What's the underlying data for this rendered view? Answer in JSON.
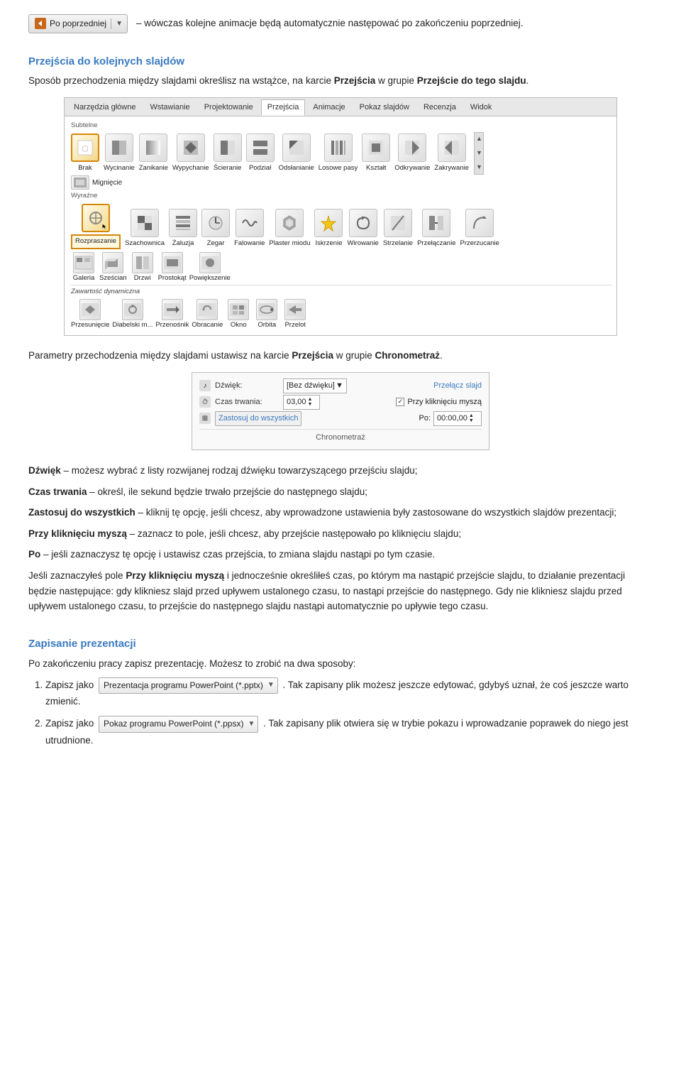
{
  "topSection": {
    "buttonLabel": "Po poprzedniej",
    "buttonDropdown": "▼",
    "topText": "– wówczas kolejne animacje będą automatycznie następować po zakończeniu poprzedniej."
  },
  "section1": {
    "heading": "Przejścia do kolejnych slajdów",
    "introText": "Sposób przechodzenia między slajdami określisz na wstążce, na karcie ",
    "introTextBold": "Przejścia",
    "introTextRest": " w grupie ",
    "introTextBold2": "Przejście do tego slajdu",
    "introTextEnd": "."
  },
  "ribbon1": {
    "tabs": [
      "Narzędzia główne",
      "Wstawianie",
      "Projektowanie",
      "Przejścia",
      "Animacje",
      "Pokaz slajdów",
      "Recenzja",
      "Widok"
    ],
    "activeTab": "Przejścia",
    "subtelneLabel": "Subtelne",
    "brakLabel": "Brak",
    "wycinaniaLabel": "Wycinanie",
    "zanikaLabel": "Zanikanie",
    "wypychanieLabel": "Wypychanie",
    "scieranieLabel": "Ścieranie",
    "podzialLabel": "Podział",
    "odslonianieLabel": "Odsłanianie",
    "losowePasyLabel": "Losowe pasy",
    "ksztaltLabel": "Kształt",
    "odkrywaniaLabel": "Odkrywanie",
    "zakrywanieLabel": "Zakrywanie",
    "mignieciLabel": "Mignięcie",
    "wyraziscieLabel": "Wyraźne",
    "rozprascanieLabel": "Rozpraszanie",
    "szachownicaLabel": "Szachownica",
    "zaluzjaLabel": "Żaluzja",
    "zegarLabel": "Zegar",
    "falowanieLabel": "Falowanie",
    "plasterMioduLabel": "Plaster miodu",
    "iskrzenieLabel": "Iskrzenie",
    "wirowanieLabel": "Wirowanie",
    "strzelanieLabel": "Strzelanie",
    "przelaczanieLabel": "Przełączanie",
    "przerzucanieLabel": "Przerzucanie",
    "galeriaLabel": "Galeria",
    "szescianLabel": "Sześcian",
    "drzwiLabel": "Drzwi",
    "prostokatLabel": "Prostokąt",
    "powiekszanieLabel": "Powiększenie",
    "zawartoscDynamicznaLabel": "Zawartość dynamiczna",
    "przesunieciLabel": "Przesunięcie",
    "diabelskiMlynLabel": "Diabelski m...",
    "przenosnikLabel": "Przenośnik",
    "obracableLabel": "Obracanie",
    "oknoLabel": "Okno",
    "orbitaLabel": "Orbita",
    "przelotLabel": "Przelot"
  },
  "section2": {
    "text": "Parametry przechodzenia między slajdami ustawisz na karcie ",
    "boldText": "Przejścia",
    "textRest": " w grupie ",
    "boldText2": "Chronometraż",
    "textEnd": "."
  },
  "chrono": {
    "row1Label": "Dźwięk:",
    "row1Value": "[Bez dźwięku]",
    "row1RightLabel": "Przełącz slajd",
    "row2Label": "Czas trwania:",
    "row2Value": "03,00",
    "row2Checkbox": "✓",
    "row2RightLabel": "Przy kliknięciu myszą",
    "row3Label": "Zastosuj do wszystkich",
    "row3RightLabel": "Po:",
    "row3RightValue": "00:00,00",
    "groupTitle": "Chronometraż"
  },
  "descriptions": {
    "dzwiekBold": "Dźwięk",
    "dzwiekText": " – możesz wybrać z listy rozwijanej rodzaj dźwięku towarzyszącego przejściu slajdu;",
    "czasBold": "Czas trwania",
    "czasText": " – określ, ile sekund będzie trwało przejście do następnego slajdu;",
    "zastosujBold": "Zastosuj do wszystkich",
    "zastosujText": " – kliknij tę opcję, jeśli chcesz, aby wprowadzone ustawienia były zastosowane do wszystkich slajdów prezentacji;",
    "przyBold": "Przy kliknięciu myszą",
    "przyText": " – zaznacz to pole, jeśli chcesz, aby przejście następowało po kliknięciu slajdu;",
    "poBold": "Po",
    "poText": " – jeśli zaznaczysz tę opcję i ustawisz czas przejścia, to zmiana slajdu nastąpi po tym czasie.",
    "extraPara": "Jeśli zaznaczyłeś pole ",
    "extraBold": "Przy kliknięciu myszą",
    "extraText": " i jednocześnie określiłeś czas, po którym ma nastąpić przejście slajdu, to działanie prezentacji będzie następujące: gdy klikniesz slajd przed upływem ustalonego czasu, to nastąpi przejście do następnego. Gdy nie klikniesz slajdu przed upływem ustalonego czasu, to przejście do następnego slajdu nastąpi automatycznie po upływie tego czasu."
  },
  "section3": {
    "heading": "Zapisanie prezentacji",
    "intro": "Po zakończeniu pracy zapisz prezentację. Możesz to zrobić na dwa sposoby:",
    "item1Pre": "Zapisz jako",
    "item1Dropdown": "Prezentacja programu PowerPoint (*.pptx)",
    "item1Post": ". Tak zapisany plik możesz jeszcze edytować, gdybyś uznał, że coś jeszcze warto zmienić.",
    "item2Pre": "Zapisz jako",
    "item2Dropdown": "Pokaz programu PowerPoint (*.ppsx)",
    "item2Post": ". Tak zapisany plik otwiera się w trybie pokazu i wprowadzanie poprawek do niego jest utrudnione."
  }
}
